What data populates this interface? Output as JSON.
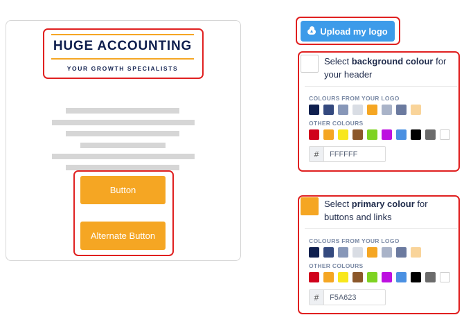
{
  "preview": {
    "logo_title": "HUGE ACCOUNTING",
    "logo_subtitle": "YOUR GROWTH SPECIALISTS",
    "button_label": "Button",
    "alternate_button_label": "Alternate Button"
  },
  "upload": {
    "label": "Upload my logo",
    "icon": "cloud-upload-icon"
  },
  "background_panel": {
    "prefix": "Select ",
    "bold": "background colour",
    "suffix_line1": " for",
    "line2": "your header",
    "current_color": "#FFFFFF",
    "logo_colours_label": "COLOURS FROM YOUR LOGO",
    "other_colours_label": "OTHER COLOURS",
    "hex_prefix": "#",
    "hex_value": "FFFFFF"
  },
  "primary_panel": {
    "prefix": "Select ",
    "bold": "primary colour",
    "suffix_line1": " for",
    "line2": "buttons and links",
    "current_color": "#F5A623",
    "logo_colours_label": "COLOURS FROM YOUR LOGO",
    "other_colours_label": "OTHER COLOURS",
    "hex_prefix": "#",
    "hex_value": "F5A623"
  },
  "logo_colours": [
    "#0F1F4E",
    "#34497E",
    "#8797B8",
    "#D9DDE4",
    "#F5A623",
    "#A9B3C8",
    "#6B7A9F",
    "#F9D49A"
  ],
  "other_colours": [
    "#D0021B",
    "#F5A623",
    "#F8E71C",
    "#8B572A",
    "#7ED321",
    "#BD10E0",
    "#4A90E2",
    "#000000",
    "#6B6B6B",
    "#FFFFFF"
  ]
}
